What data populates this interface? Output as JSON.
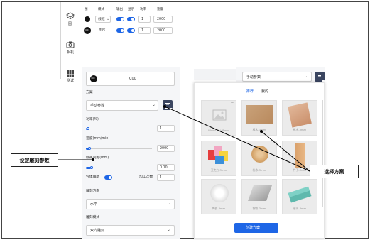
{
  "sidebar": {
    "layers": "图",
    "camera": "相机",
    "test": "测试"
  },
  "layers": {
    "headers": [
      "图",
      "模式",
      "输出",
      "显示",
      "功率",
      "速度"
    ],
    "rows": [
      {
        "mode": "线框",
        "power": "1",
        "speed": "2000"
      },
      {
        "badge": "C00",
        "mode": "图片",
        "power": "1",
        "speed": "2000"
      }
    ]
  },
  "params": {
    "layer_badge": "C00",
    "layer_code": "C00",
    "scheme_label": "方案",
    "scheme_value": "手动参数",
    "power_label": "功率(%)",
    "power_value": "1",
    "speed_label": "速度(mm/min)",
    "speed_value": "2000",
    "line_spacing_label": "线条间距(mm)",
    "line_spacing_value": "0.10",
    "air_assist_label": "气体辅助",
    "passes_label": "加工次数",
    "passes_value": "1",
    "direction_label": "雕刻方向",
    "direction_value": "水平",
    "mode_label": "雕刻模式",
    "mode_value": "双向雕刻"
  },
  "popup": {
    "select_value": "手动参数",
    "tabs": [
      "推荐",
      "我的"
    ],
    "cards": [
      "Wood-Cut-8mm",
      "板木-3mm",
      "板木-3mm",
      "亚克力-3mm",
      "松木-3mm",
      "竹子-3mm",
      "陶瓷-3mm",
      "钢铁-3mm",
      "玻璃-3mm"
    ],
    "create_button": "创建方案"
  },
  "annotations": {
    "left": "设定雕刻参数",
    "right": "选择方案"
  },
  "colors": {
    "accent": "#1e66e6",
    "save_button": "#3a4560"
  }
}
